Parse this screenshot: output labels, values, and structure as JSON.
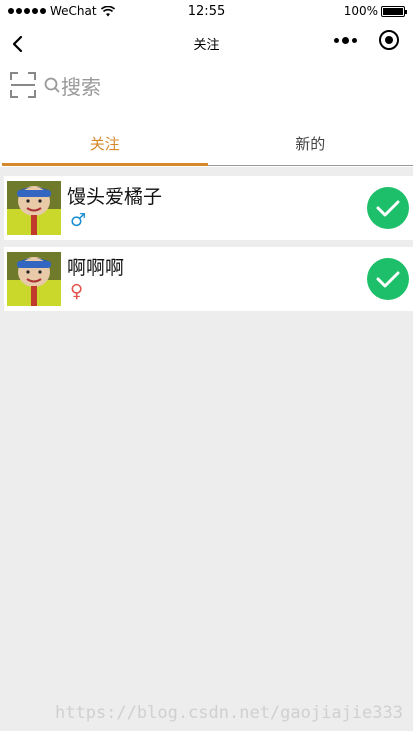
{
  "status_bar": {
    "carrier": "WeChat",
    "time": "12:55",
    "battery": "100%",
    "battery_level": 1.0
  },
  "nav": {
    "title": "关注"
  },
  "search": {
    "placeholder": "搜索"
  },
  "tabs": [
    {
      "label": "关注",
      "active": true
    },
    {
      "label": "新的",
      "active": false
    }
  ],
  "list": [
    {
      "name": "馒头爱橘子",
      "gender": "♂",
      "gender_type": "male"
    },
    {
      "name": "啊啊啊",
      "gender": "♀",
      "gender_type": "female"
    }
  ],
  "colors": {
    "accent": "#d7882a",
    "check": "#1dbf6a",
    "male": "#1a8fd1",
    "female": "#e4524e"
  },
  "watermark": "https://blog.csdn.net/gaojiajie333"
}
